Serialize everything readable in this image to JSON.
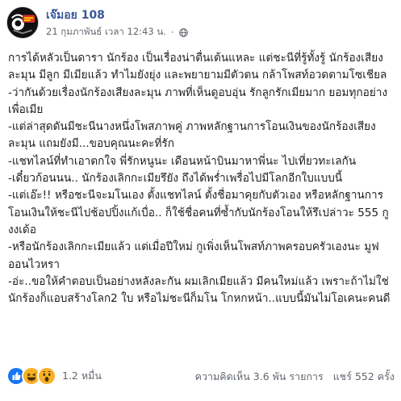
{
  "post": {
    "page_name": "เจ๊มอย 108",
    "timestamp": "21 กุมภาพันธ์ เวลา 12:43 น.",
    "separator": "·",
    "privacy_icon": "globe-icon",
    "paragraphs": [
      "การได้หลัวเป็นดารา นักร้อง เป็นเรื่องน่าตื่นเต้นแหละ แต่ชะนีที่รู้ทั้งรู้ นักร้องเสียงละมุน มีลูก มีเมียแล้ว ทำไมยังยุ่ง และพยายามมีตัวตน กล้าโพสท์อวดตามโซเชียล",
      "-ว่ากันด้วยเรื่องนักร้องเสียงละมุน ภาพที่เห็นดูอบอุ่น รักลูกรักเมียมาก ยอมทุกอย่างเพื่อเมีย",
      "-แต่ล่าสุดดันมีชะนีนางหนึ่งโพสภาพคู่ ภาพหลักฐานการโอนเงินของนักร้องเสียงละมุน แถมยังมี...ขอบคุณนะคะที่รัก",
      "-แชทไลน์ที่ทำเอาตกใจ พี่รักหนูนะ เดือนหน้าบินมาหาพี่นะ ไปเที่ยวทะเลกัน",
      "-เดี๋ยวก้อนนน.. นักร้องเลิกกะเมียรึยัง ถึงได้พร่ำเพรื่อไปมีโลกอีกใบแบบนี้",
      "-แต่เอ๊ะ!! หรือชะนีจะมโนเอง ตั้งแชทไลน์ ตั้งชื่อมาคุยกับตัวเอง หรือหลักฐานการโอนเงินให้ชะนีไปช้อปปิ้งแก้เบื่อ.. ก็ใช้ชื่อคนที่ซ้ำกับนักร้องโอนให้รึเปล่าวะ 555 กูงงเด้อ",
      "-หรือนักร้องเลิกกะเมียแล้ว แต่เมื่อปีใหม่ กูเพิ่งเห็นโพสท์ภาพครอบครัวเองนะ มูฟออนไวหรา",
      "-อ่ะ..ขอให้คำตอบเป็นอย่างหลังละกัน ผมเลิกเมียแล้ว มีคนใหม่แล้ว เพราะถ้าไม่ใช่นักร้องก็แอบสร้างโลก2 ใบ หรือไม่ชะนีก็มโน โกหกหน้า..แบบนี้มันไม่โอเคนะคนดี"
    ]
  },
  "footer": {
    "reactions": [
      {
        "name": "like-icon",
        "color": "#1877f2"
      },
      {
        "name": "haha-icon",
        "color": "#f7b125"
      },
      {
        "name": "wow-icon",
        "color": "#f7b125"
      }
    ],
    "reaction_count": "1.2 หมื่น",
    "comments": "ความคิดเห็น 3.6 พัน รายการ",
    "shares": "แชร์ 552 ครั้ง"
  },
  "colors": {
    "page_name": "#385898",
    "meta_text": "#616770",
    "body_text": "#1c1e21"
  }
}
